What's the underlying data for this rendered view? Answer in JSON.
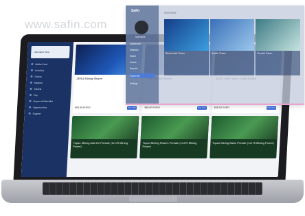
{
  "watermark": "www.safin.com",
  "laptop": {
    "sidebar": {
      "user": "Username Here",
      "items": [
        {
          "label": "Wallet Card"
        },
        {
          "label": "Activities"
        },
        {
          "label": "Orders"
        },
        {
          "label": "Markets"
        },
        {
          "label": "Tokens"
        },
        {
          "label": "Pay"
        },
        {
          "label": "Buyers & Watchlist"
        },
        {
          "label": "Opportunities"
        },
        {
          "label": "Support"
        }
      ]
    },
    "cards": [
      {
        "title": "ZENG Mining Shares",
        "price": "$60.00 EURO",
        "buy": "Buy Now"
      },
      {
        "title": "ZENG Mining Shares",
        "price": "$48.00 EURO",
        "buy": "Buy Now"
      },
      {
        "title": "ZENG Yield Token - Utility Edition",
        "price": "$65.00 EURO",
        "buy": "Buy Now"
      },
      {
        "title": "Tupan Mining Add-On Presale (1x175 Mining Power)"
      },
      {
        "title": "Tupan Mining Shares Presale (1x175 Mining Power)"
      },
      {
        "title": "Tupan Mining Basic Presale (1x175 Mining Power)"
      }
    ]
  },
  "panel": {
    "logo": "Safin",
    "user": "Username",
    "title": "Overview",
    "items": [
      "Dashboard",
      "Statistics",
      "Wallet",
      "Assets",
      "Reports",
      "Payments",
      "Settings"
    ],
    "cards": [
      {
        "title": "Blockchain Token"
      },
      {
        "title": "Health Token"
      },
      {
        "title": "Growth Token"
      }
    ]
  }
}
